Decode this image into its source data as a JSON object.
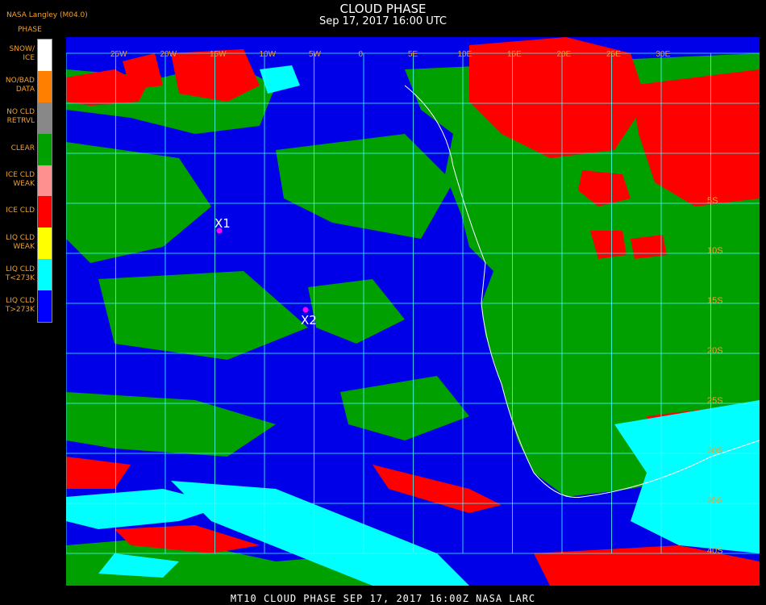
{
  "header": {
    "credit": "NASA Langley (M04.0)",
    "title": "CLOUD PHASE",
    "subtitle": "Sep 17, 2017 16:00 UTC"
  },
  "legend": {
    "heading": "PHASE",
    "items": [
      {
        "label": "SNOW/\nICE",
        "color": "#ffffff"
      },
      {
        "label": "NO/BAD\nDATA",
        "color": "#ff8000"
      },
      {
        "label": "NO CLD\nRETRVL",
        "color": "#888888"
      },
      {
        "label": "CLEAR",
        "color": "#00a000"
      },
      {
        "label": "ICE CLD\nWEAK",
        "color": "#ff9090"
      },
      {
        "label": "ICE CLD",
        "color": "#ff0000"
      },
      {
        "label": "LIQ CLD\nWEAK",
        "color": "#ffff00"
      },
      {
        "label": "LIQ CLD\nT<273K",
        "color": "#00ffff"
      },
      {
        "label": "LIQ CLD\nT>273K",
        "color": "#0000ff"
      }
    ]
  },
  "markers": [
    {
      "label": "X1"
    },
    {
      "label": "X2"
    }
  ],
  "lat_labels": [
    "5S",
    "10S",
    "15S",
    "20S",
    "25S",
    "30S",
    "35S",
    "40S"
  ],
  "top_labels": [
    "25W",
    "20W",
    "15W",
    "10W",
    "5W",
    "0",
    "5E",
    "10E",
    "15E",
    "20E",
    "25E",
    "30E"
  ],
  "footer": "MT10   CLOUD PHASE   SEP 17, 2017 16:00Z   NASA LARC",
  "colors": {
    "grid": "#40ffff",
    "coast": "#ffffff",
    "label": "#f0a030",
    "marker": "#ff00ff"
  }
}
